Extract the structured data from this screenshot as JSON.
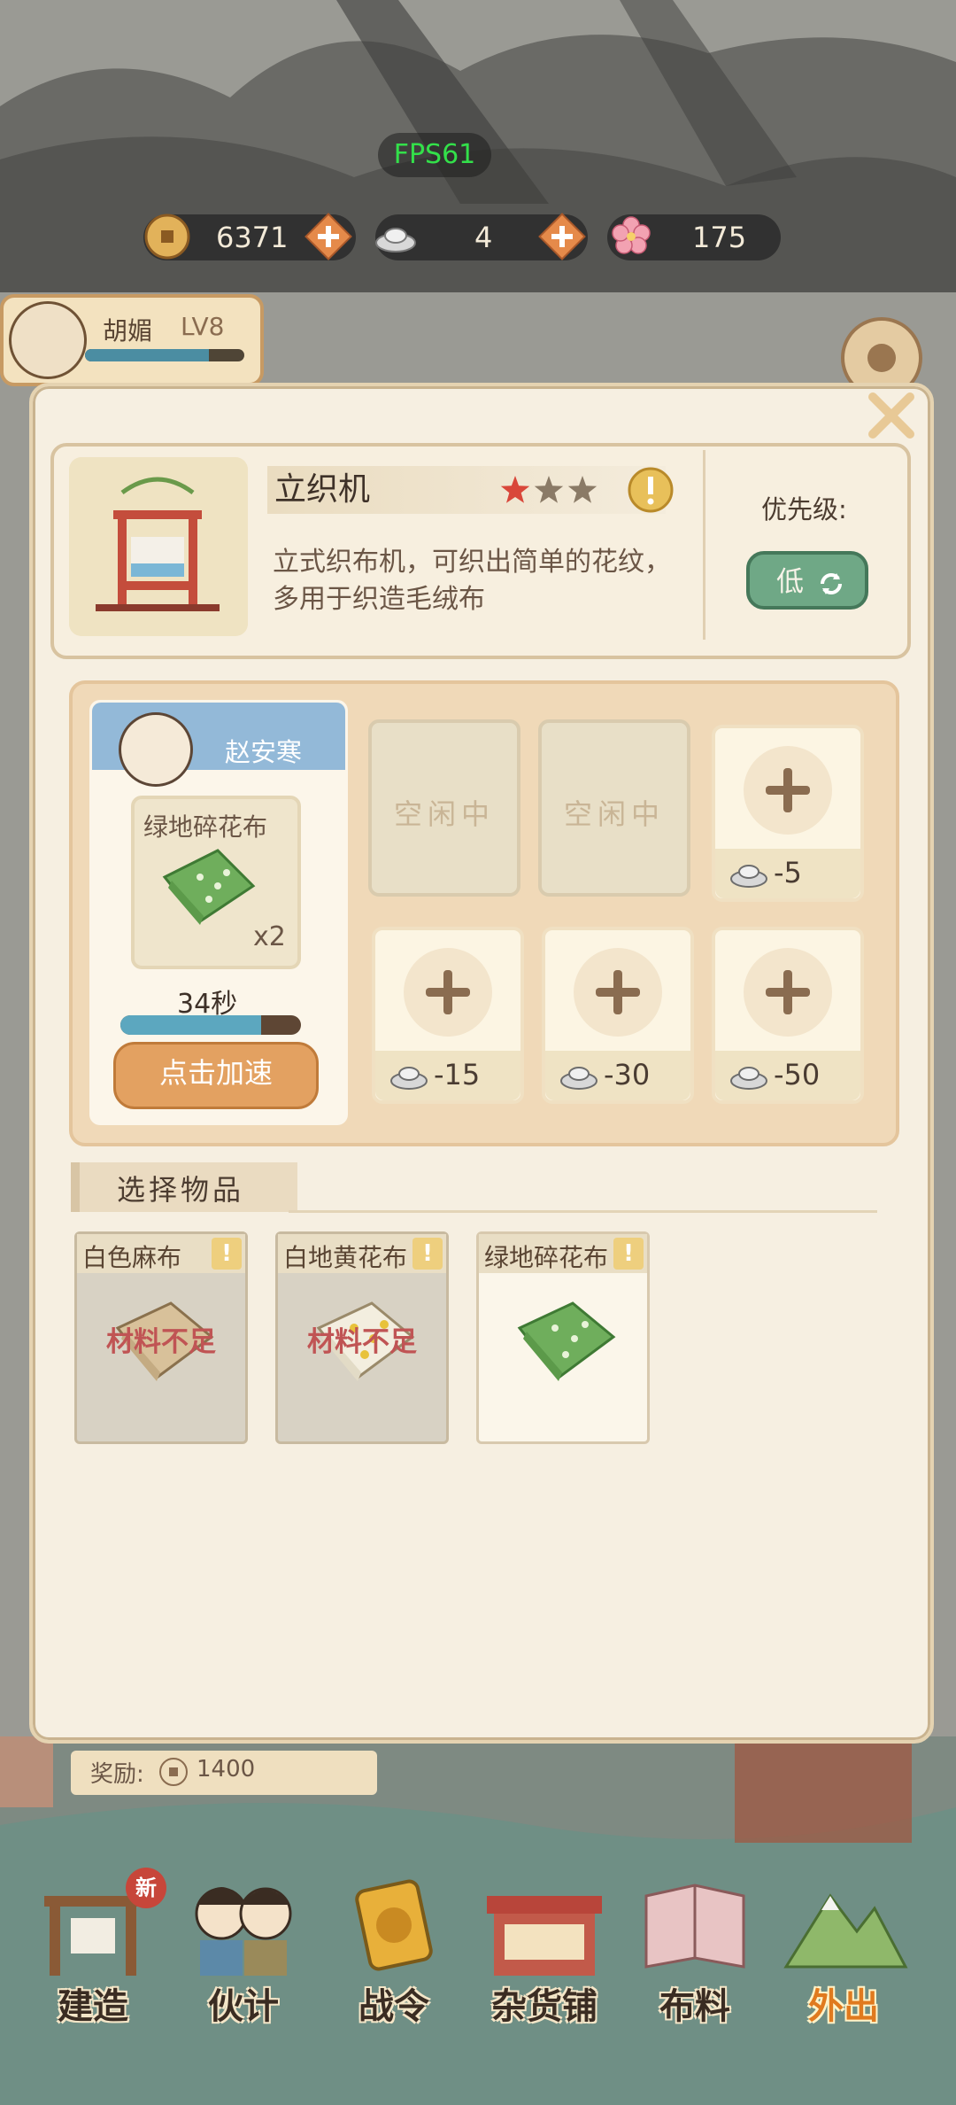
{
  "hud": {
    "fps": "FPS61",
    "coins": "6371",
    "silver": "4",
    "flowers": "175"
  },
  "player": {
    "name": "胡媚",
    "level": "LV8",
    "xp_fraction": 0.78
  },
  "machine": {
    "name": "立织机",
    "stars_filled": 1,
    "stars_total": 3,
    "description": "立式织布机，可织出简单的花纹，多用于织造毛绒布",
    "priority_label": "优先级:",
    "priority_value": "低"
  },
  "worker": {
    "name": "赵安寒",
    "product_name": "绿地碎花布",
    "product_qty": "x2",
    "timer": "34秒",
    "progress_fraction": 0.78,
    "speed_button": "点击加速"
  },
  "slots": {
    "idle_label": "空闲中",
    "unlock_costs": [
      "-5",
      "-15",
      "-30",
      "-50"
    ]
  },
  "item_select": {
    "title": "选择物品",
    "lack_text": "材料不足",
    "items": [
      {
        "name": "白色麻布",
        "lacking": true
      },
      {
        "name": "白地黄花布",
        "lacking": true
      },
      {
        "name": "绿地碎花布",
        "lacking": false
      }
    ]
  },
  "reward": {
    "label": "奖励:",
    "value": "1400"
  },
  "nav": {
    "items": [
      "建造",
      "伙计",
      "战令",
      "杂货铺",
      "布料",
      "外出"
    ],
    "new_badge": "新",
    "active_index": 5
  },
  "colors": {
    "accent_orange": "#e3a161",
    "priority_green": "#6fa886",
    "panel_bg": "#f6efe1",
    "worker_header_blue": "#93b9d8"
  }
}
